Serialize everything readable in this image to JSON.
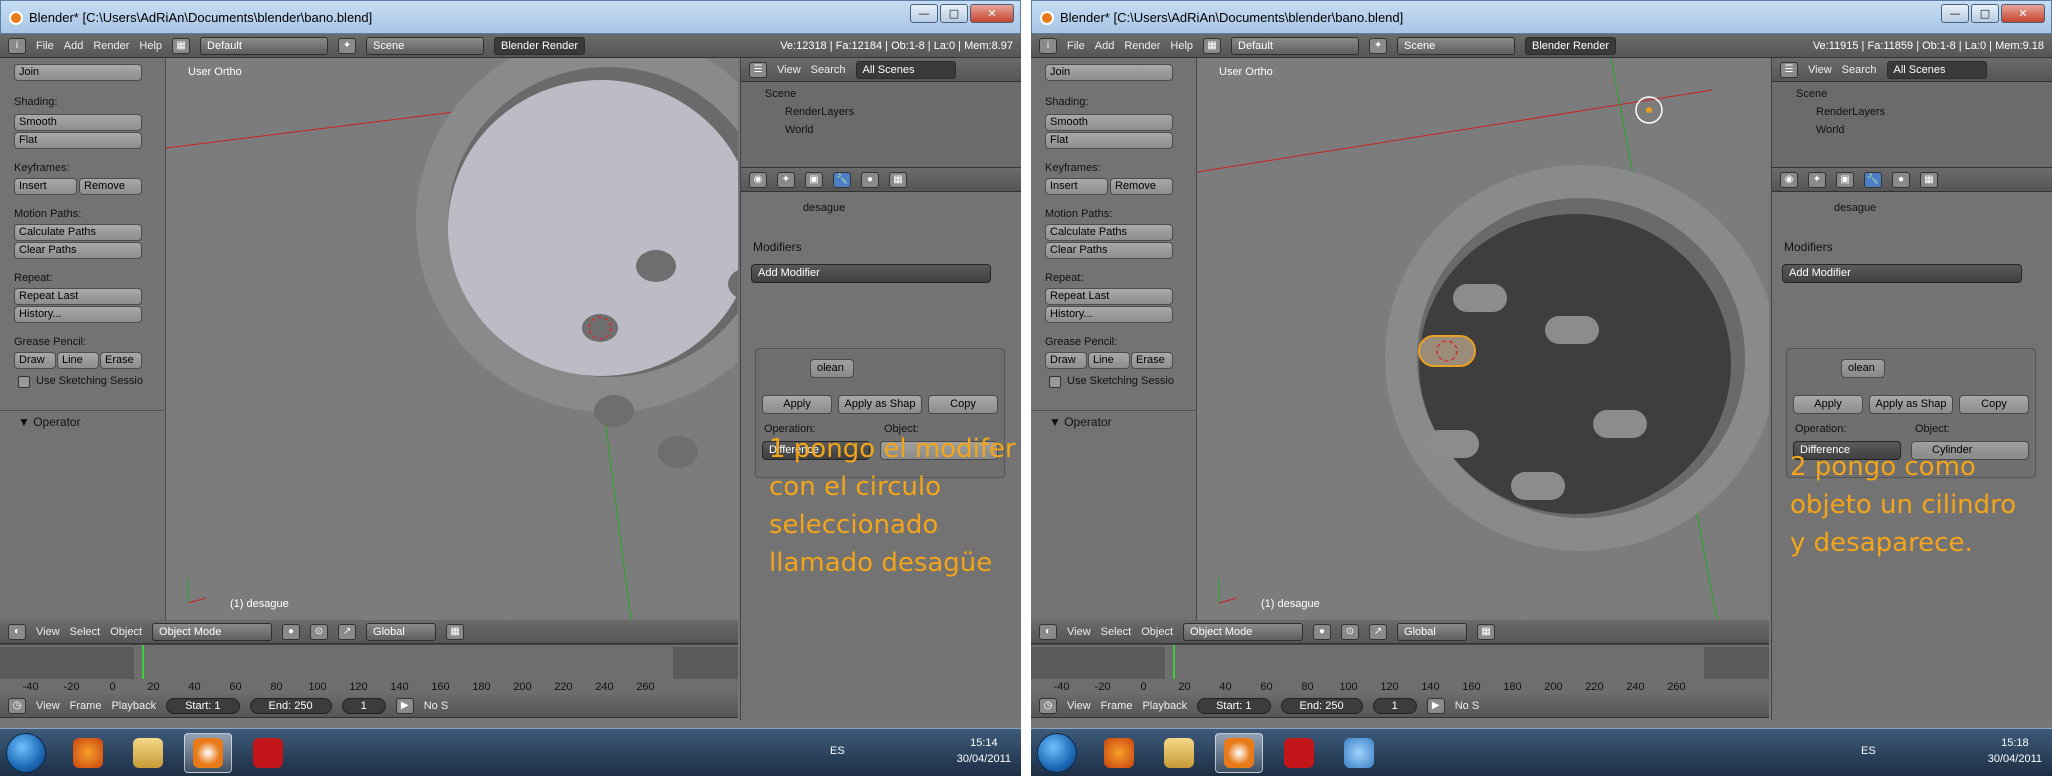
{
  "colors": {
    "accent": "#f2a51a",
    "viewport": "#7c7c7c",
    "panel": "#737373",
    "timeline_cursor": "#3ccf3c"
  },
  "shots": [
    {
      "window_title": "Blender* [C:\\Users\\AdRiAn\\Documents\\blender\\bano.blend]",
      "menus": [
        "File",
        "Add",
        "Render",
        "Help"
      ],
      "layout": "Default",
      "scene": "Scene",
      "engine": "Blender Render",
      "stats": "Ve:12318 | Fa:12184 | Ob:1-8 | La:0 | Mem:8.97",
      "toolshelf": {
        "join": "Join",
        "shading": "Shading:",
        "smooth": "Smooth",
        "flat": "Flat",
        "keyframes": "Keyframes:",
        "insert": "Insert",
        "remove": "Remove",
        "motion_paths": "Motion Paths:",
        "calc_paths": "Calculate Paths",
        "clear_paths": "Clear Paths",
        "repeat": "Repeat:",
        "repeat_last": "Repeat Last",
        "history": "History...",
        "grease_pencil": "Grease Pencil:",
        "draw": "Draw",
        "line": "Line",
        "erase": "Erase",
        "use_sketching": "Use Sketching Sessio",
        "operator": "Operator"
      },
      "viewport": {
        "view_label": "User Ortho",
        "object_label": "(1) desague"
      },
      "viewbar": {
        "view": "View",
        "select": "Select",
        "object": "Object",
        "mode": "Object Mode",
        "orientation": "Global"
      },
      "timeline_ticks": [
        "-40",
        "-20",
        "0",
        "20",
        "40",
        "60",
        "80",
        "100",
        "120",
        "140",
        "160",
        "180",
        "200",
        "220",
        "240",
        "260"
      ],
      "timelinebar": {
        "view": "View",
        "frame": "Frame",
        "playback": "Playback",
        "start": "Start: 1",
        "end": "End: 250",
        "current": "1",
        "nosync": "No S"
      },
      "outliner": {
        "view": "View",
        "search": "Search",
        "filter": "All Scenes",
        "scene": "Scene",
        "renderlayers": "RenderLayers",
        "world": "World"
      },
      "properties": {
        "object_name": "desague",
        "modifiers": "Modifiers",
        "add_modifier": "Add Modifier",
        "mod_name": "olean",
        "apply": "Apply",
        "apply_shape": "Apply as Shap",
        "copy": "Copy",
        "operation_label": "Operation:",
        "operation": "Difference",
        "object_label": "Object:",
        "object_value": ""
      },
      "annotation": "1 pongo el modifer\ncon el circulo\nseleccionado\nllamado desagüe",
      "clock": {
        "time": "15:14",
        "date": "30/04/2011"
      },
      "lang": "ES"
    },
    {
      "window_title": "Blender* [C:\\Users\\AdRiAn\\Documents\\blender\\bano.blend]",
      "menus": [
        "File",
        "Add",
        "Render",
        "Help"
      ],
      "layout": "Default",
      "scene": "Scene",
      "engine": "Blender Render",
      "stats": "Ve:11915 | Fa:11859 | Ob:1-8 | La:0 | Mem:9.18",
      "toolshelf": {
        "join": "Join",
        "shading": "Shading:",
        "smooth": "Smooth",
        "flat": "Flat",
        "keyframes": "Keyframes:",
        "insert": "Insert",
        "remove": "Remove",
        "motion_paths": "Motion Paths:",
        "calc_paths": "Calculate Paths",
        "clear_paths": "Clear Paths",
        "repeat": "Repeat:",
        "repeat_last": "Repeat Last",
        "history": "History...",
        "grease_pencil": "Grease Pencil:",
        "draw": "Draw",
        "line": "Line",
        "erase": "Erase",
        "use_sketching": "Use Sketching Sessio",
        "operator": "Operator"
      },
      "viewport": {
        "view_label": "User Ortho",
        "object_label": "(1) desague"
      },
      "viewbar": {
        "view": "View",
        "select": "Select",
        "object": "Object",
        "mode": "Object Mode",
        "orientation": "Global"
      },
      "timeline_ticks": [
        "-40",
        "-20",
        "0",
        "20",
        "40",
        "60",
        "80",
        "100",
        "120",
        "140",
        "160",
        "180",
        "200",
        "220",
        "240",
        "260"
      ],
      "timelinebar": {
        "view": "View",
        "frame": "Frame",
        "playback": "Playback",
        "start": "Start: 1",
        "end": "End: 250",
        "current": "1",
        "nosync": "No S"
      },
      "outliner": {
        "view": "View",
        "search": "Search",
        "filter": "All Scenes",
        "scene": "Scene",
        "renderlayers": "RenderLayers",
        "world": "World"
      },
      "properties": {
        "object_name": "desague",
        "modifiers": "Modifiers",
        "add_modifier": "Add Modifier",
        "mod_name": "olean",
        "apply": "Apply",
        "apply_shape": "Apply as Shap",
        "copy": "Copy",
        "operation_label": "Operation:",
        "operation": "Difference",
        "object_label": "Object:",
        "object_value": "Cylinder"
      },
      "annotation": "2 pongo como\nobjeto un cilindro\ny desaparece.",
      "clock": {
        "time": "15:18",
        "date": "30/04/2011"
      },
      "lang": "ES"
    }
  ]
}
